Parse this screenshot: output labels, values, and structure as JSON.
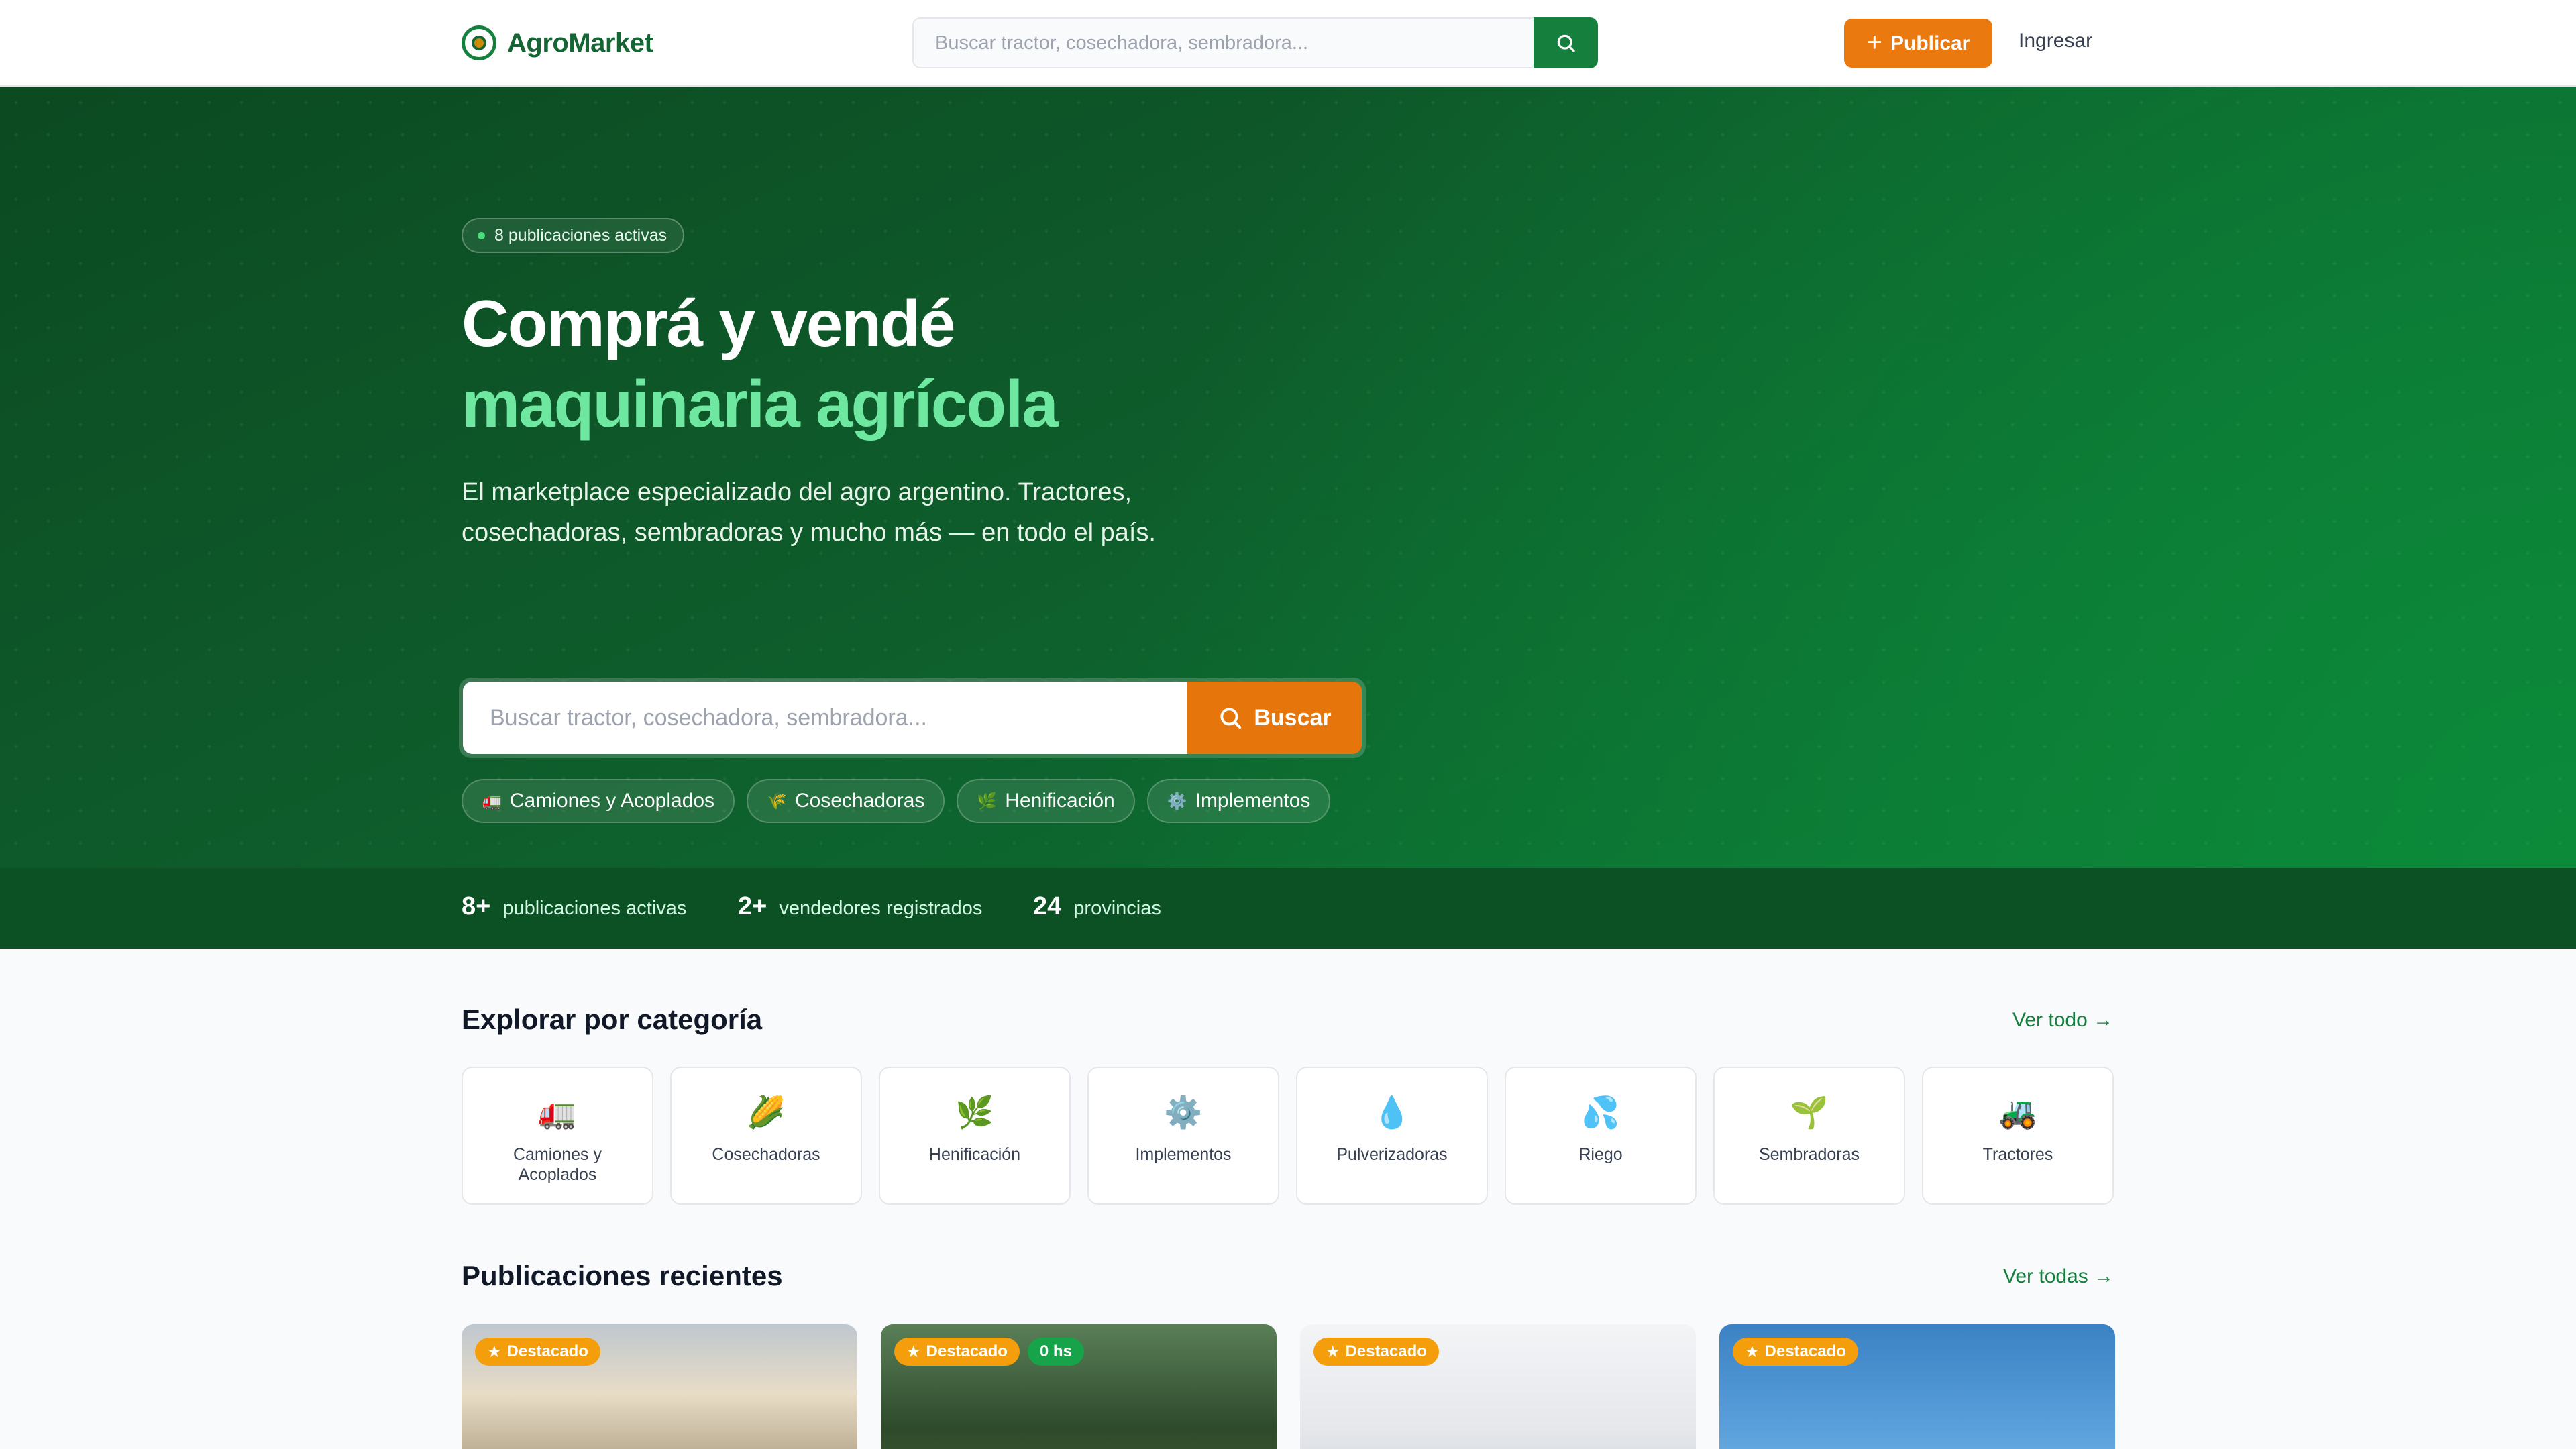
{
  "brand": {
    "name": "AgroMarket"
  },
  "header": {
    "search_placeholder": "Buscar tractor, cosechadora, sembradora...",
    "publish_label": "Publicar",
    "login_label": "Ingresar"
  },
  "hero": {
    "badge": "8 publicaciones activas",
    "title_line1": "Comprá y vendé",
    "title_line2": "maquinaria agrícola",
    "subtitle": "El marketplace especializado del agro argentino. Tractores, cosechadoras, sembradoras y mucho más — en todo el país.",
    "search_placeholder": "Buscar tractor, cosechadora, sembradora...",
    "search_button": "Buscar",
    "chips": [
      {
        "icon": "🚛",
        "label": "Camiones y Acoplados"
      },
      {
        "icon": "🌾",
        "label": "Cosechadoras"
      },
      {
        "icon": "🌿",
        "label": "Henificación"
      },
      {
        "icon": "⚙️",
        "label": "Implementos"
      }
    ]
  },
  "stats": [
    {
      "value": "8+",
      "label": "publicaciones activas"
    },
    {
      "value": "2+",
      "label": "vendedores registrados"
    },
    {
      "value": "24",
      "label": "provincias"
    }
  ],
  "categories": {
    "title": "Explorar por categoría",
    "see_all": "Ver todo →",
    "items": [
      {
        "icon": "🚛",
        "label": "Camiones y Acoplados"
      },
      {
        "icon": "🌽",
        "label": "Cosechadoras"
      },
      {
        "icon": "🌿",
        "label": "Henificación"
      },
      {
        "icon": "⚙️",
        "label": "Implementos"
      },
      {
        "icon": "💧",
        "label": "Pulverizadoras"
      },
      {
        "icon": "💦",
        "label": "Riego"
      },
      {
        "icon": "🌱",
        "label": "Sembradoras"
      },
      {
        "icon": "🚜",
        "label": "Tractores"
      }
    ]
  },
  "listings": {
    "title": "Publicaciones recientes",
    "see_all": "Ver todas →",
    "cards": [
      {
        "featured": "Destacado",
        "time": ""
      },
      {
        "featured": "Destacado",
        "time": "0 hs"
      },
      {
        "featured": "Destacado",
        "time": ""
      },
      {
        "featured": "Destacado",
        "time": ""
      }
    ]
  },
  "colors": {
    "primary": "#15803d",
    "accent": "#ea7a0f",
    "hero_highlight": "#6ee7a0"
  }
}
